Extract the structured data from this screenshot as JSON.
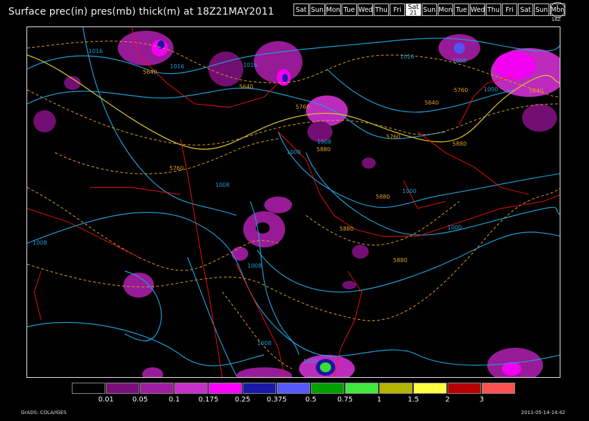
{
  "title": "Surface prec(in) pres(mb) thick(m) at 18Z21MAY2011",
  "days": [
    {
      "label": "Sat"
    },
    {
      "label": "Sun"
    },
    {
      "label": "Mon"
    },
    {
      "label": "Tue"
    },
    {
      "label": "Wed"
    },
    {
      "label": "Thu"
    },
    {
      "label": "Fri"
    },
    {
      "label": "Sat",
      "sub": "21",
      "active": true
    },
    {
      "label": "Sun"
    },
    {
      "label": "Mon"
    },
    {
      "label": "Tue"
    },
    {
      "label": "Wed"
    },
    {
      "label": "Thu"
    },
    {
      "label": "Fri"
    },
    {
      "label": "Sat"
    },
    {
      "label": "Sun"
    },
    {
      "label": "Mon"
    }
  ],
  "clock_label": "18Z",
  "isobar_labels": [
    "1016",
    "1016",
    "1016",
    "1016",
    "1008",
    "1008",
    "1008",
    "1008",
    "1008",
    "1008",
    "1008",
    "1000",
    "1000",
    "1000",
    "1000"
  ],
  "thickness_labels": [
    "5640",
    "5640",
    "5760",
    "5760",
    "5760",
    "5640",
    "5760",
    "5640",
    "5880",
    "5880",
    "5880",
    "5880",
    "5880"
  ],
  "legend": {
    "colors": [
      "#000000",
      "#7a0f7a",
      "#a01ca0",
      "#c82ec8",
      "#ff00ff",
      "#1a1aaa",
      "#5858ff",
      "#00a000",
      "#40e840",
      "#b4b400",
      "#ffff40",
      "#b40000",
      "#ff5050"
    ],
    "ticks": [
      "0.01",
      "0.05",
      "0.1",
      "0.175",
      "0.25",
      "0.375",
      "0.5",
      "0.75",
      "1",
      "1.5",
      "2",
      "3"
    ]
  },
  "footer_left": "GrADS: COLA/IGES",
  "footer_right": "2011-05-14-14:42",
  "colors": {
    "isobar": "#1e9fd6",
    "thickness": "#e0a020",
    "borders": "#ff1010"
  }
}
